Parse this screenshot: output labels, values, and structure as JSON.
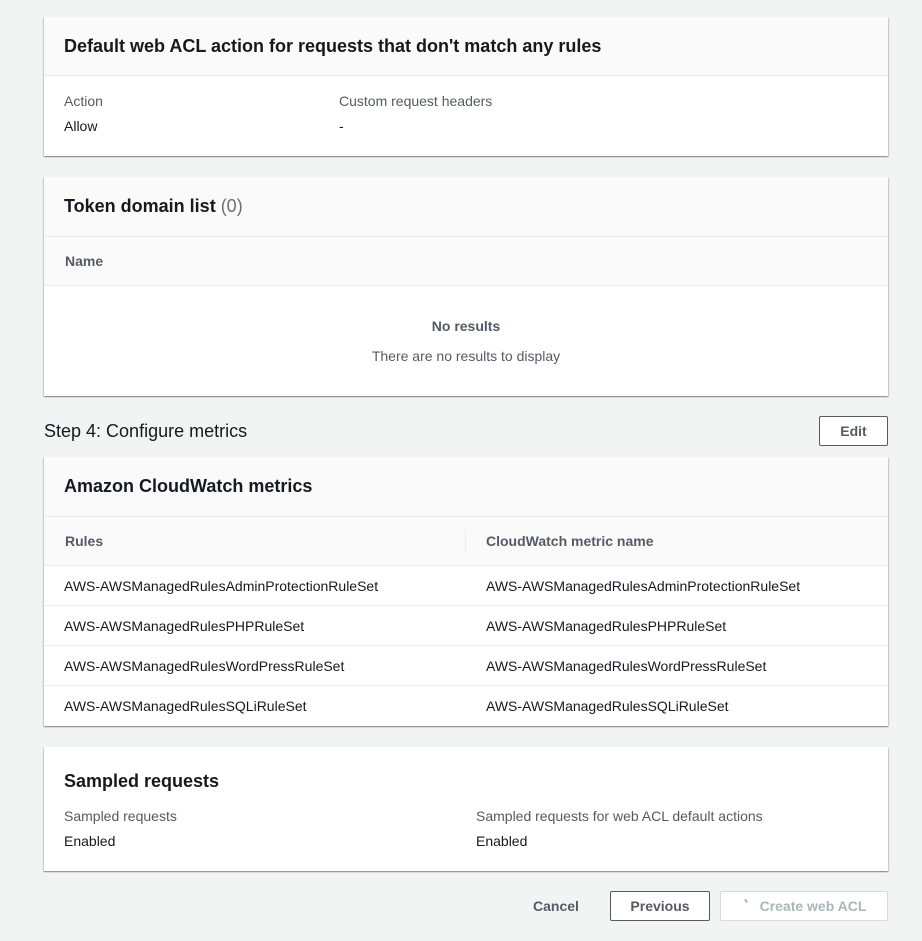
{
  "default_action": {
    "title": "Default web ACL action for requests that don't match any rules",
    "action_label": "Action",
    "action_value": "Allow",
    "headers_label": "Custom request headers",
    "headers_value": "-"
  },
  "token_domain": {
    "title": "Token domain list",
    "count": "(0)",
    "column_name": "Name",
    "empty_title": "No results",
    "empty_desc": "There are no results to display"
  },
  "step4": {
    "title": "Step 4: Configure metrics",
    "edit_label": "Edit"
  },
  "cloudwatch": {
    "title": "Amazon CloudWatch metrics",
    "columns": [
      "Rules",
      "CloudWatch metric name"
    ],
    "rows": [
      {
        "rule": "AWS-AWSManagedRulesAdminProtectionRuleSet",
        "metric": "AWS-AWSManagedRulesAdminProtectionRuleSet"
      },
      {
        "rule": "AWS-AWSManagedRulesPHPRuleSet",
        "metric": "AWS-AWSManagedRulesPHPRuleSet"
      },
      {
        "rule": "AWS-AWSManagedRulesWordPressRuleSet",
        "metric": "AWS-AWSManagedRulesWordPressRuleSet"
      },
      {
        "rule": "AWS-AWSManagedRulesSQLiRuleSet",
        "metric": "AWS-AWSManagedRulesSQLiRuleSet"
      }
    ]
  },
  "sampled": {
    "title": "Sampled requests",
    "left_label": "Sampled requests",
    "left_value": "Enabled",
    "right_label": "Sampled requests for web ACL default actions",
    "right_value": "Enabled"
  },
  "footer": {
    "cancel_label": "Cancel",
    "previous_label": "Previous",
    "create_label": "Create web ACL"
  }
}
